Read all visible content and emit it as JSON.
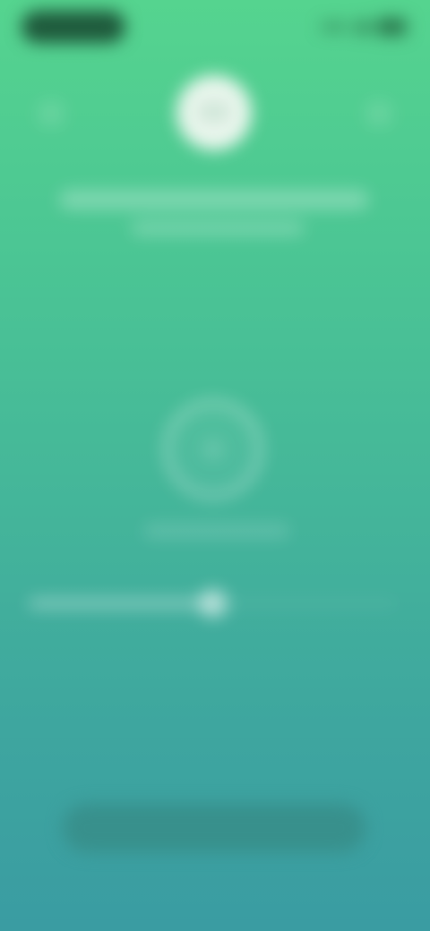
{
  "status_bar": {
    "time": "",
    "battery_icon": "battery-icon",
    "wifi_icon": "wifi-icon",
    "signal_icon": "signal-icon"
  },
  "header": {
    "left_icon": "back-icon",
    "right_icon": "more-icon",
    "avatar_icon": "avatar-icon"
  },
  "content": {
    "title": "",
    "subtitle": ""
  },
  "timer": {
    "icon": "timer-icon",
    "caption": ""
  },
  "slider": {
    "value_fraction": 0.5
  },
  "primary_button": {
    "label": ""
  },
  "colors": {
    "gradient_top": "#55d48f",
    "gradient_bottom": "#3a9ca2",
    "button": "#38908c",
    "status_pill": "#1f5a3c"
  }
}
